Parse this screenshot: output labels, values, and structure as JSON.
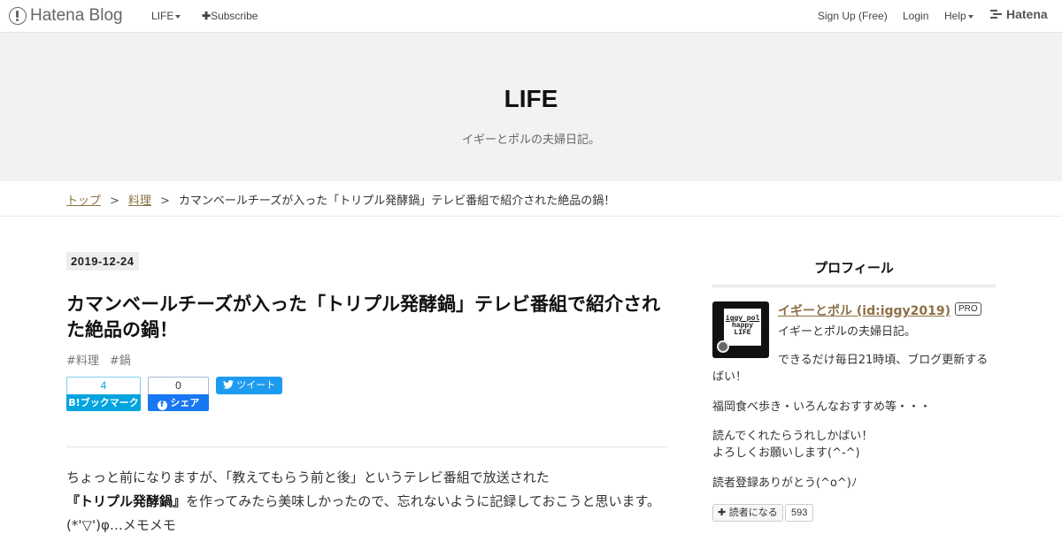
{
  "global_header": {
    "logo_text": "Hatena Blog",
    "menu_label": "LIFE",
    "subscribe_label": "Subscribe",
    "signup_label": "Sign Up (Free)",
    "login_label": "Login",
    "help_label": "Help",
    "hatena_label": "Hatena"
  },
  "blog": {
    "title": "LIFE",
    "description": "イギーとポルの夫婦日記。"
  },
  "breadcrumb": {
    "items": [
      "トップ",
      "料理"
    ],
    "separator": ">",
    "current": "カマンベールチーズが入った「トリプル発酵鍋」テレビ番組で紹介された絶品の鍋！"
  },
  "article": {
    "date": "2019-12-24",
    "title": "カマンベールチーズが入った「トリプル発酵鍋」テレビ番組で紹介された絶品の鍋！",
    "categories": [
      "#料理",
      "#鍋"
    ],
    "share": {
      "bookmark_count": "4",
      "bookmark_label": "B!ブックマーク",
      "facebook_count": "0",
      "facebook_label": "シェア",
      "tweet_label": "ツイート"
    },
    "body": {
      "part1": "ちょっと前になりますが、「教えてもらう前と後」というテレビ番組で放送された",
      "highlight": "『トリプル発酵鍋』",
      "part2": "を作ってみたら美味しかったので、忘れないように記録しておこうと思います。(*'▽')φ…メモメモ"
    }
  },
  "sidebar": {
    "heading": "プロフィール",
    "avatar_text": [
      "iggy pol",
      "happy",
      "LIFE"
    ],
    "profile_name": "イギーとポル (id:iggy2019)",
    "pro_badge": "PRO",
    "lines": [
      "イギーとポルの夫婦日記。",
      "できるだけ毎日21時頃、ブログ更新するばい！",
      "福岡食べ歩き・いろんなおすすめ等・・・",
      "読んでくれたらうれしかばい！",
      "よろしくお願いします(^-^)",
      "読者登録ありがとう(^o^)ﾉ"
    ],
    "follow_label": "読者になる",
    "follower_count": "593"
  },
  "colors": {
    "link": "#8d7146",
    "header_bg": "#f2f2f2",
    "bookmark_blue": "#00a4de",
    "facebook_blue": "#1877f2",
    "twitter_blue": "#1d9bf0"
  }
}
